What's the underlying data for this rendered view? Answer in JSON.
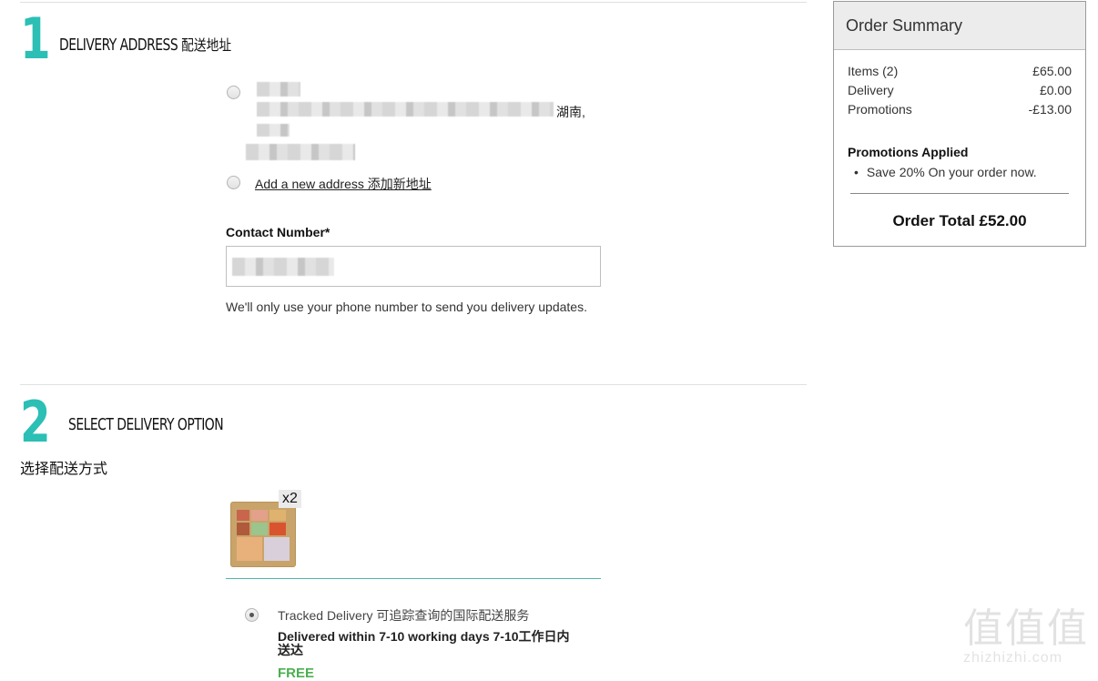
{
  "step1": {
    "number": "1",
    "title": "DELIVERY ADDRESS",
    "title_cn": "配送地址",
    "address_fragment": "湖南,",
    "add_address_label": "Add a new address 添加新地址",
    "contact_label": "Contact Number*",
    "help_text": "We'll only use your phone number to send you delivery updates."
  },
  "step2": {
    "number": "2",
    "title": "SELECT DELIVERY OPTION",
    "subtitle_cn": "选择配送方式",
    "quantity": "x2",
    "option_name": "Tracked Delivery 可追踪查询的国际配送服务",
    "option_detail": "Delivered within 7-10 working days 7-10工作日内送达",
    "option_price": "FREE",
    "price_color": "#4caf50"
  },
  "summary": {
    "title": "Order Summary",
    "rows": [
      {
        "label": "Items (2)",
        "value": "£65.00"
      },
      {
        "label": "Delivery",
        "value": "£0.00"
      },
      {
        "label": "Promotions",
        "value": "-£13.00"
      }
    ],
    "promotions_title": "Promotions Applied",
    "promotions": [
      "Save 20% On your order now."
    ],
    "total": "Order Total £52.00"
  },
  "watermark": {
    "glyphs": "值值值",
    "url": "zhizhizhi.com"
  },
  "accent_color": "#2bbfb5"
}
